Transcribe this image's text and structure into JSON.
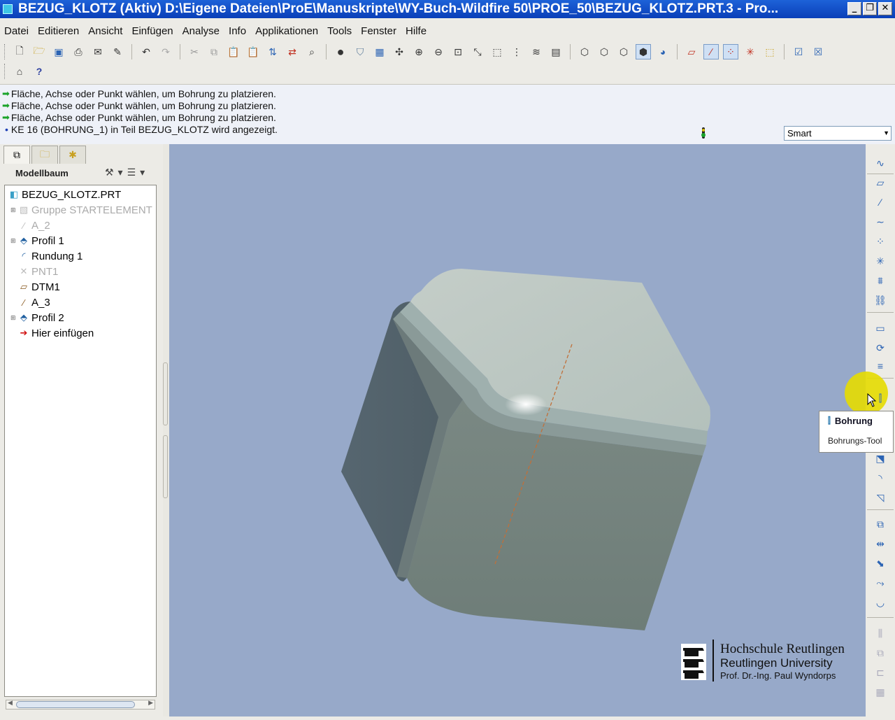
{
  "window": {
    "title": "BEZUG_KLOTZ (Aktiv) D:\\Eigene Dateien\\ProE\\Manuskripte\\WY-Buch-Wildfire 50\\PROE_50\\BEZUG_KLOTZ.PRT.3 - Pro...",
    "minimize": "_",
    "maximize": "❐",
    "close": "✕"
  },
  "menu": [
    "Datei",
    "Editieren",
    "Ansicht",
    "Einfügen",
    "Analyse",
    "Info",
    "Applikationen",
    "Tools",
    "Fenster",
    "Hilfe"
  ],
  "messages": [
    "Fläche, Achse oder Punkt wählen, um Bohrung zu platzieren.",
    "Fläche, Achse oder Punkt wählen, um Bohrung zu platzieren.",
    "Fläche, Achse oder Punkt wählen, um Bohrung zu platzieren.",
    "KE 16 (BOHRUNG_1) in Teil BEZUG_KLOTZ wird angezeigt."
  ],
  "filter": {
    "value": "Smart"
  },
  "modeltree": {
    "header": "Modellbaum",
    "items": [
      {
        "label": "BEZUG_KLOTZ.PRT",
        "icon": "part-icon",
        "dim": false,
        "expander": false,
        "indent": 0
      },
      {
        "label": "Gruppe STARTELEMENT",
        "icon": "group-icon",
        "dim": true,
        "expander": true,
        "indent": 1
      },
      {
        "label": "A_2",
        "icon": "axis-icon",
        "dim": true,
        "expander": false,
        "indent": 1
      },
      {
        "label": "Profil 1",
        "icon": "protrusion-icon",
        "dim": false,
        "expander": true,
        "indent": 1
      },
      {
        "label": "Rundung 1",
        "icon": "round-icon",
        "dim": false,
        "expander": false,
        "indent": 1
      },
      {
        "label": "PNT1",
        "icon": "point-icon",
        "dim": true,
        "expander": false,
        "indent": 1
      },
      {
        "label": "DTM1",
        "icon": "datum-plane-icon",
        "dim": false,
        "expander": false,
        "indent": 1
      },
      {
        "label": "A_3",
        "icon": "axis-icon",
        "dim": false,
        "expander": false,
        "indent": 1
      },
      {
        "label": "Profil 2",
        "icon": "protrusion-icon",
        "dim": false,
        "expander": true,
        "indent": 1
      },
      {
        "label": "Hier einfügen",
        "icon": "insert-here-icon",
        "dim": false,
        "expander": false,
        "indent": 1
      }
    ]
  },
  "tooltip": {
    "title": "Bohrung",
    "description": "Bohrungs-Tool"
  },
  "logo": {
    "line1": "Hochschule Reutlingen",
    "line2": "Reutlingen University",
    "line3": "Prof. Dr.-Ing. Paul Wyndorps"
  },
  "colors": {
    "titlebar": "#0a3fb8",
    "viewport_bg": "#97a9c9",
    "highlight": "#e6dc00",
    "message_arrow": "#1aa32a"
  }
}
